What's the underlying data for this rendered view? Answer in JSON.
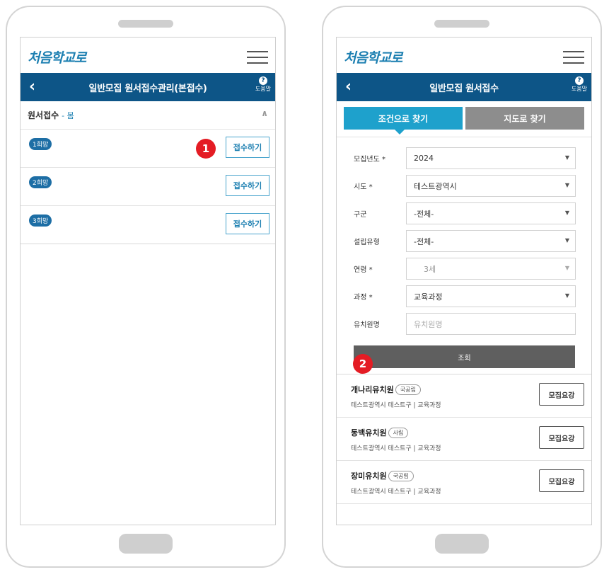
{
  "left": {
    "logo": "처음학교로",
    "title": "일반모집 원서접수관리(본접수)",
    "help_label": "도움말",
    "help_icon": "?",
    "section": {
      "label": "원서접수",
      "sub": "- 봄"
    },
    "wishes": [
      {
        "badge": "1희망",
        "button": "접수하기"
      },
      {
        "badge": "2희망",
        "button": "접수하기"
      },
      {
        "badge": "3희망",
        "button": "접수하기"
      }
    ],
    "marker": "1"
  },
  "right": {
    "logo": "처음학교로",
    "title": "일반모집 원서접수",
    "help_label": "도움말",
    "help_icon": "?",
    "tabs": [
      "조건으로 찾기",
      "지도로 찾기"
    ],
    "form": [
      {
        "label": "모집년도 *",
        "value": "2024",
        "type": "select"
      },
      {
        "label": "시도 *",
        "value": "테스트광역시",
        "type": "select"
      },
      {
        "label": "구군",
        "value": "-전체-",
        "type": "select"
      },
      {
        "label": "설립유형",
        "value": "-전체-",
        "type": "select"
      },
      {
        "label": "연령 *",
        "value": "3세",
        "type": "disabled"
      },
      {
        "label": "과정 *",
        "value": "교육과정",
        "type": "select"
      },
      {
        "label": "유치원명",
        "placeholder": "유치원명",
        "type": "input"
      }
    ],
    "search_label": "조회",
    "marker": "2",
    "results": [
      {
        "name": "개나리유치원",
        "tag": "국공립",
        "meta": "테스트광역시 테스트구 | 교육과정",
        "button": "모집요강"
      },
      {
        "name": "동백유치원",
        "tag": "사립",
        "meta": "테스트광역시 테스트구 | 교육과정",
        "button": "모집요강"
      },
      {
        "name": "장미유치원",
        "tag": "국공립",
        "meta": "테스트광역시 테스트구 | 교육과정",
        "button": "모집요강"
      }
    ]
  },
  "colors": {
    "brand": "#0d5587",
    "accent": "#1ea1cc",
    "marker": "#e41c24"
  },
  "icons": {
    "back": "chevron-left-icon",
    "menu": "hamburger-icon",
    "collapse": "chevron-up-icon",
    "dropdown": "caret-down-icon"
  }
}
